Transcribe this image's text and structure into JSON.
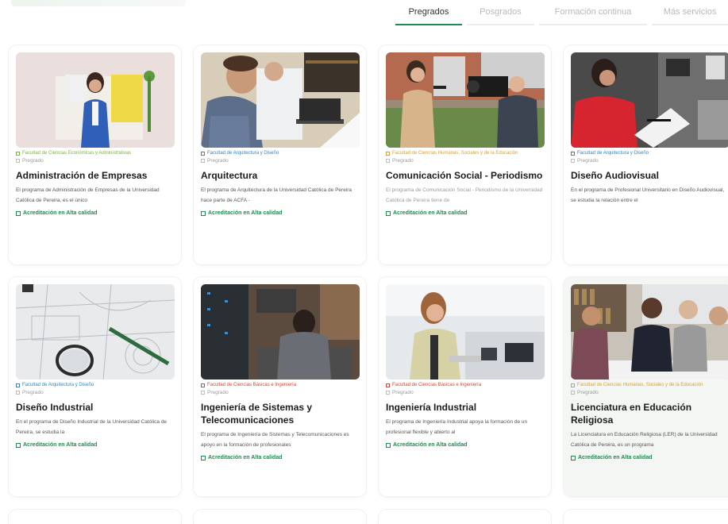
{
  "colors": {
    "accent": "#1f8a52",
    "fac_green": "#7bb53a",
    "fac_blue": "#2a86c7",
    "fac_orange": "#e0a020",
    "fac_red": "#d9452e"
  },
  "tabs": [
    {
      "label": "Pregrados",
      "active": true
    },
    {
      "label": "Posgrados",
      "active": false
    },
    {
      "label": "Formación continua",
      "active": false
    },
    {
      "label": "Más servicios",
      "active": false
    }
  ],
  "cards": [
    {
      "faculty": "Facultad de Ciencias Económicas y Administrativas",
      "faculty_color": "#7bb53a",
      "level": "Pregrado",
      "title": "Administración de Empresas",
      "desc": "El programa de Administración de Empresas de la Universidad Católica de Pereira, es el único",
      "accreditation": "Acreditación en Alta calidad",
      "image": "businesswoman-photo"
    },
    {
      "faculty": "Facultad de Arquitectura y Diseño",
      "faculty_color": "#2a86c7",
      "level": "Pregrado",
      "title": "Arquitectura",
      "desc": "El programa de Arquitectura de la Universidad Católica de Pereira hace parte de ACFA -",
      "accreditation": "Acreditación en Alta calidad",
      "image": "architects-photo"
    },
    {
      "faculty": "Facultad de Ciencias Humanas, Sociales y de la Educación",
      "faculty_color": "#e0a020",
      "level": "Pregrado",
      "title": "Comunicación Social - Periodismo",
      "desc": "El programa de Comunicación Social - Periodismo de la Universidad Católica de Pereira tiene de",
      "accreditation": "Acreditación en Alta calidad",
      "image": "reporter-photo"
    },
    {
      "faculty": "Facultad de Arquitectura y Diseño",
      "faculty_color": "#2a86c7",
      "level": "Pregrado",
      "title": "Diseño Audiovisual",
      "desc": "En el programa de Profesional Universitario en Diseño Audiovisual, se estudia la relación entre el",
      "accreditation": "",
      "image": "studio-photo"
    },
    {
      "faculty": "Facultad de Arquitectura y Diseño",
      "faculty_color": "#2a86c7",
      "level": "Pregrado",
      "title": "Diseño Industrial",
      "desc": "En el programa de Diseño Industrial de la Universidad Católica de Pereira, se estudia la",
      "accreditation": "Acreditación en Alta calidad",
      "image": "blueprint-photo"
    },
    {
      "faculty": "Facultad de Ciencias Básicas e Ingeniería",
      "faculty_color": "#d9452e",
      "level": "Pregrado",
      "title": "Ingeniería de Sistemas y Telecomunicaciones",
      "desc": "El programa de Ingeniería de Sistemas y Telecomunicaciones es apoyo en la formación de profesionales",
      "accreditation": "Acreditación en Alta calidad",
      "image": "server-room-photo"
    },
    {
      "faculty": "Facultad de Ciencias Básicas e Ingeniería",
      "faculty_color": "#d9452e",
      "level": "Pregrado",
      "title": "Ingeniería Industrial",
      "desc": "El programa de Ingeniería Industrial apoya la formación de un profesional flexible y abierto al",
      "accreditation": "Acreditación en Alta calidad",
      "image": "engineer-photo"
    },
    {
      "faculty": "Facultad de Ciencias Humanas, Sociales y de la Educación",
      "faculty_color": "#e0a020",
      "level": "Pregrado",
      "title": "Licenciatura en Educación Religiosa",
      "desc": "La Licenciatura en Educación Religiosa (LER) de la Universidad Católica de Pereira, es un programa",
      "accreditation": "Acreditación en Alta calidad",
      "image": "group-study-photo"
    }
  ]
}
